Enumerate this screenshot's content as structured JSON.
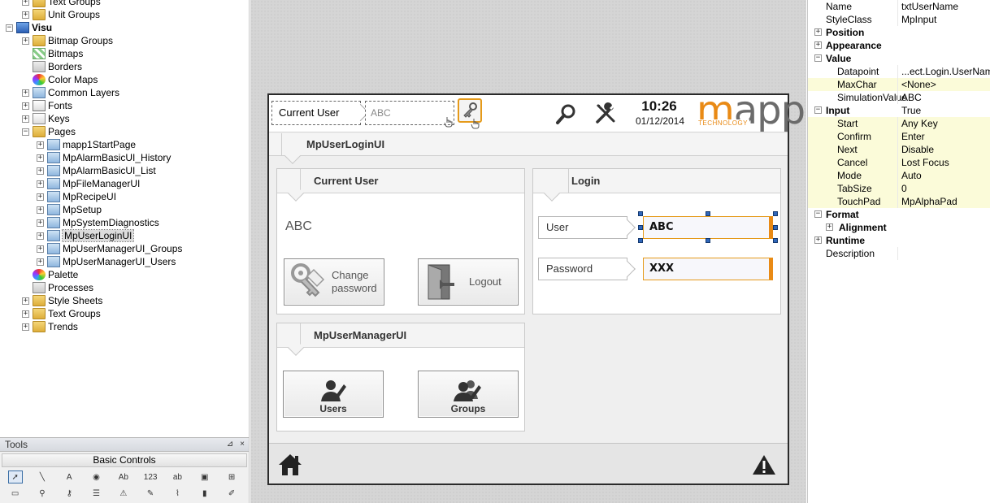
{
  "tree": {
    "top_items": [
      {
        "label": "Text Groups",
        "icon": "text-groups-icon",
        "expander": "+"
      },
      {
        "label": "Unit Groups",
        "icon": "unit-groups-icon",
        "expander": "+"
      }
    ],
    "root": {
      "label": "Visu",
      "expander": "−"
    },
    "visu_items": [
      {
        "label": "Bitmap Groups",
        "icon": "bitmap-groups-icon",
        "expander": "+"
      },
      {
        "label": "Bitmaps",
        "icon": "bitmaps-icon",
        "expander": ""
      },
      {
        "label": "Borders",
        "icon": "borders-icon",
        "expander": ""
      },
      {
        "label": "Color Maps",
        "icon": "color-maps-icon",
        "expander": ""
      },
      {
        "label": "Common Layers",
        "icon": "common-layers-icon",
        "expander": "+"
      },
      {
        "label": "Fonts",
        "icon": "fonts-icon",
        "expander": "+"
      },
      {
        "label": "Keys",
        "icon": "keys-icon",
        "expander": "+"
      },
      {
        "label": "Pages",
        "icon": "pages-icon",
        "expander": "−"
      }
    ],
    "pages": [
      {
        "label": "mapp1StartPage",
        "selected": false
      },
      {
        "label": "MpAlarmBasicUI_History",
        "selected": false
      },
      {
        "label": "MpAlarmBasicUI_List",
        "selected": false
      },
      {
        "label": "MpFileManagerUI",
        "selected": false
      },
      {
        "label": "MpRecipeUI",
        "selected": false
      },
      {
        "label": "MpSetup",
        "selected": false
      },
      {
        "label": "MpSystemDiagnostics",
        "selected": false
      },
      {
        "label": "MpUserLoginUI",
        "selected": true
      },
      {
        "label": "MpUserManagerUI_Groups",
        "selected": false
      },
      {
        "label": "MpUserManagerUI_Users",
        "selected": false
      }
    ],
    "bottom_items": [
      {
        "label": "Palette",
        "icon": "palette-icon",
        "expander": ""
      },
      {
        "label": "Processes",
        "icon": "processes-icon",
        "expander": ""
      },
      {
        "label": "Style Sheets",
        "icon": "style-sheets-icon",
        "expander": "+"
      },
      {
        "label": "Text Groups",
        "icon": "text-groups-icon",
        "expander": "+"
      },
      {
        "label": "Trends",
        "icon": "trends-icon",
        "expander": "+"
      }
    ]
  },
  "tools": {
    "title": "Tools",
    "pin_glyph": "⊿",
    "close_glyph": "×",
    "category": "Basic Controls",
    "row1": [
      {
        "name": "pointer-tool-icon",
        "glyph": "➚"
      },
      {
        "name": "line-tool-icon",
        "glyph": "╲"
      },
      {
        "name": "text-tool-icon",
        "glyph": "A"
      },
      {
        "name": "shape-tool-icon",
        "glyph": "◉"
      },
      {
        "name": "string-field-tool-icon",
        "glyph": "Ab"
      },
      {
        "name": "numeric-field-tool-icon",
        "glyph": "123"
      },
      {
        "name": "input-field-tool-icon",
        "glyph": "ab"
      },
      {
        "name": "bitmap-tool-icon",
        "glyph": "▣"
      },
      {
        "name": "add-tool-icon",
        "glyph": "⊞"
      }
    ],
    "row2": [
      {
        "name": "bar-tool-icon",
        "glyph": "▭"
      },
      {
        "name": "search-tool-icon",
        "glyph": "⚲"
      },
      {
        "name": "key-tool-icon",
        "glyph": "⚷"
      },
      {
        "name": "list-tool-icon",
        "glyph": "☰"
      },
      {
        "name": "alarm-tool-icon",
        "glyph": "⚠"
      },
      {
        "name": "edit-tool-icon",
        "glyph": "✎"
      },
      {
        "name": "trend-tool-icon",
        "glyph": "⌇"
      },
      {
        "name": "gauge-tool-icon",
        "glyph": "▮"
      },
      {
        "name": "scroll-tool-icon",
        "glyph": "✐"
      }
    ]
  },
  "visu": {
    "header": {
      "current_user_label": "Current User",
      "current_user_value": "ABC",
      "time": "10:26",
      "date": "01/12/2014",
      "logo_m": "m",
      "logo_rest": "app",
      "logo_sub": "TECHNOLOGY"
    },
    "page_title": "MpUserLoginUI",
    "current_user_panel": {
      "title": "Current User",
      "user": "ABC",
      "change_password_line1": "Change",
      "change_password_line2": "password",
      "logout_label": "Logout"
    },
    "login_panel": {
      "title": "Login",
      "user_label": "User",
      "user_value": "ABC",
      "password_label": "Password",
      "password_value": "XXX"
    },
    "manager_panel": {
      "title": "MpUserManagerUI",
      "users_label": "Users",
      "groups_label": "Groups"
    }
  },
  "props": {
    "rows": [
      {
        "kind": "prop",
        "name": "Name",
        "value": "txtUserName",
        "hl": false
      },
      {
        "kind": "prop",
        "name": "StyleClass",
        "value": "MpInput",
        "hl": false
      },
      {
        "kind": "cat",
        "name": "Position",
        "expander": "+"
      },
      {
        "kind": "cat",
        "name": "Appearance",
        "expander": "+"
      },
      {
        "kind": "cat",
        "name": "Value",
        "expander": "−"
      },
      {
        "kind": "sub",
        "name": "Datapoint",
        "value": "...ect.Login.UserName",
        "hl": false
      },
      {
        "kind": "sub",
        "name": "MaxChar",
        "value": "<None>",
        "hl": true
      },
      {
        "kind": "sub",
        "name": "SimulationValue",
        "value": "ABC",
        "hl": false
      },
      {
        "kind": "cat",
        "name": "Input",
        "expander": "−",
        "value": "True"
      },
      {
        "kind": "sub",
        "name": "Start",
        "value": "Any Key",
        "hl": true
      },
      {
        "kind": "sub",
        "name": "Confirm",
        "value": "Enter",
        "hl": true
      },
      {
        "kind": "sub",
        "name": "Next",
        "value": "Disable",
        "hl": true
      },
      {
        "kind": "sub",
        "name": "Cancel",
        "value": "Lost Focus",
        "hl": true
      },
      {
        "kind": "sub",
        "name": "Mode",
        "value": "Auto",
        "hl": true
      },
      {
        "kind": "sub",
        "name": "TabSize",
        "value": "0",
        "hl": true
      },
      {
        "kind": "sub",
        "name": "TouchPad",
        "value": "MpAlphaPad",
        "hl": true
      },
      {
        "kind": "cat",
        "name": "Format",
        "expander": "−"
      },
      {
        "kind": "subcat",
        "name": "Alignment",
        "expander": "+"
      },
      {
        "kind": "cat",
        "name": "Runtime",
        "expander": "+"
      },
      {
        "kind": "prop",
        "name": "Description",
        "value": "",
        "hl": false
      }
    ]
  },
  "colors": {
    "accent": "#e98a15",
    "selection_handle": "#2f66b9",
    "property_highlight": "#fbfbd9"
  }
}
